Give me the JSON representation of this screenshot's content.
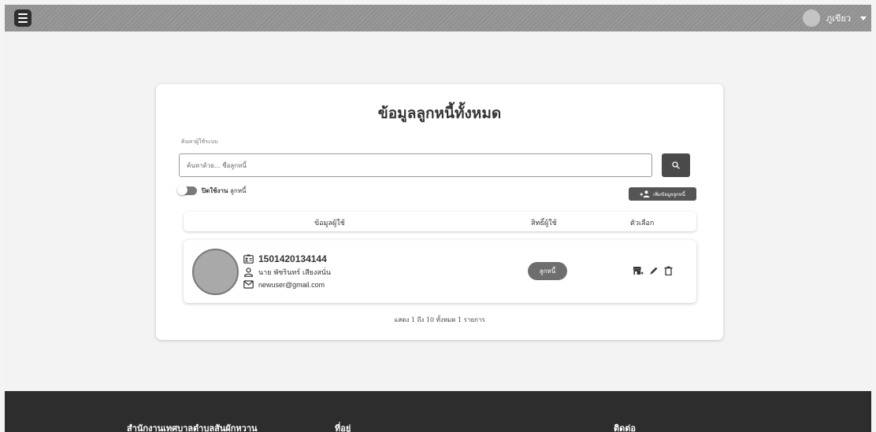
{
  "header": {
    "user_name": "ภูเขียว",
    "icons": [
      "menu-icon",
      "user-avatar",
      "caret-down-icon"
    ]
  },
  "main": {
    "title": "ข้อมูลลูกหนี้ทั้งหมด",
    "search": {
      "label": "ค้นหาผู้ใช้ระบบ",
      "placeholder": "ค้นหาด้วย... ชื่อลูกหนี้",
      "value": ""
    },
    "toggle": {
      "bold_label": "ปิดใช้งาน",
      "label": "ลูกหนี้",
      "checked": false
    },
    "add_button": "เพิ่มข้อมูลลูกหนี้",
    "table": {
      "headers": [
        "ข้อมูลผู้ใช้",
        "สิทธิ์ผู้ใช้",
        "ตัวเลือก"
      ],
      "rows": [
        {
          "id_number": "1501420134144",
          "name": "นาย พัชรินทร์ เสียงสนั่น",
          "email": "newuser@gmail.com",
          "role": "ลูกหนี้",
          "actions": [
            "store-icon",
            "edit-icon",
            "delete-icon"
          ]
        }
      ]
    },
    "pagination_text": "แสดง 1 ถึง 10 ทั้งหมด 1 รายการ"
  },
  "footer": {
    "org_name": "สำนักงานเทศบาลตำบลสันผักหวาน",
    "address_heading": "ที่อยู่",
    "contact_heading": "ติดต่อ"
  },
  "colors": {
    "topbar": "#999999",
    "button_dark": "#4a4a4a",
    "footer": "#2d2d2d",
    "card": "#ffffff",
    "page_bg": "#f3f3f3"
  }
}
